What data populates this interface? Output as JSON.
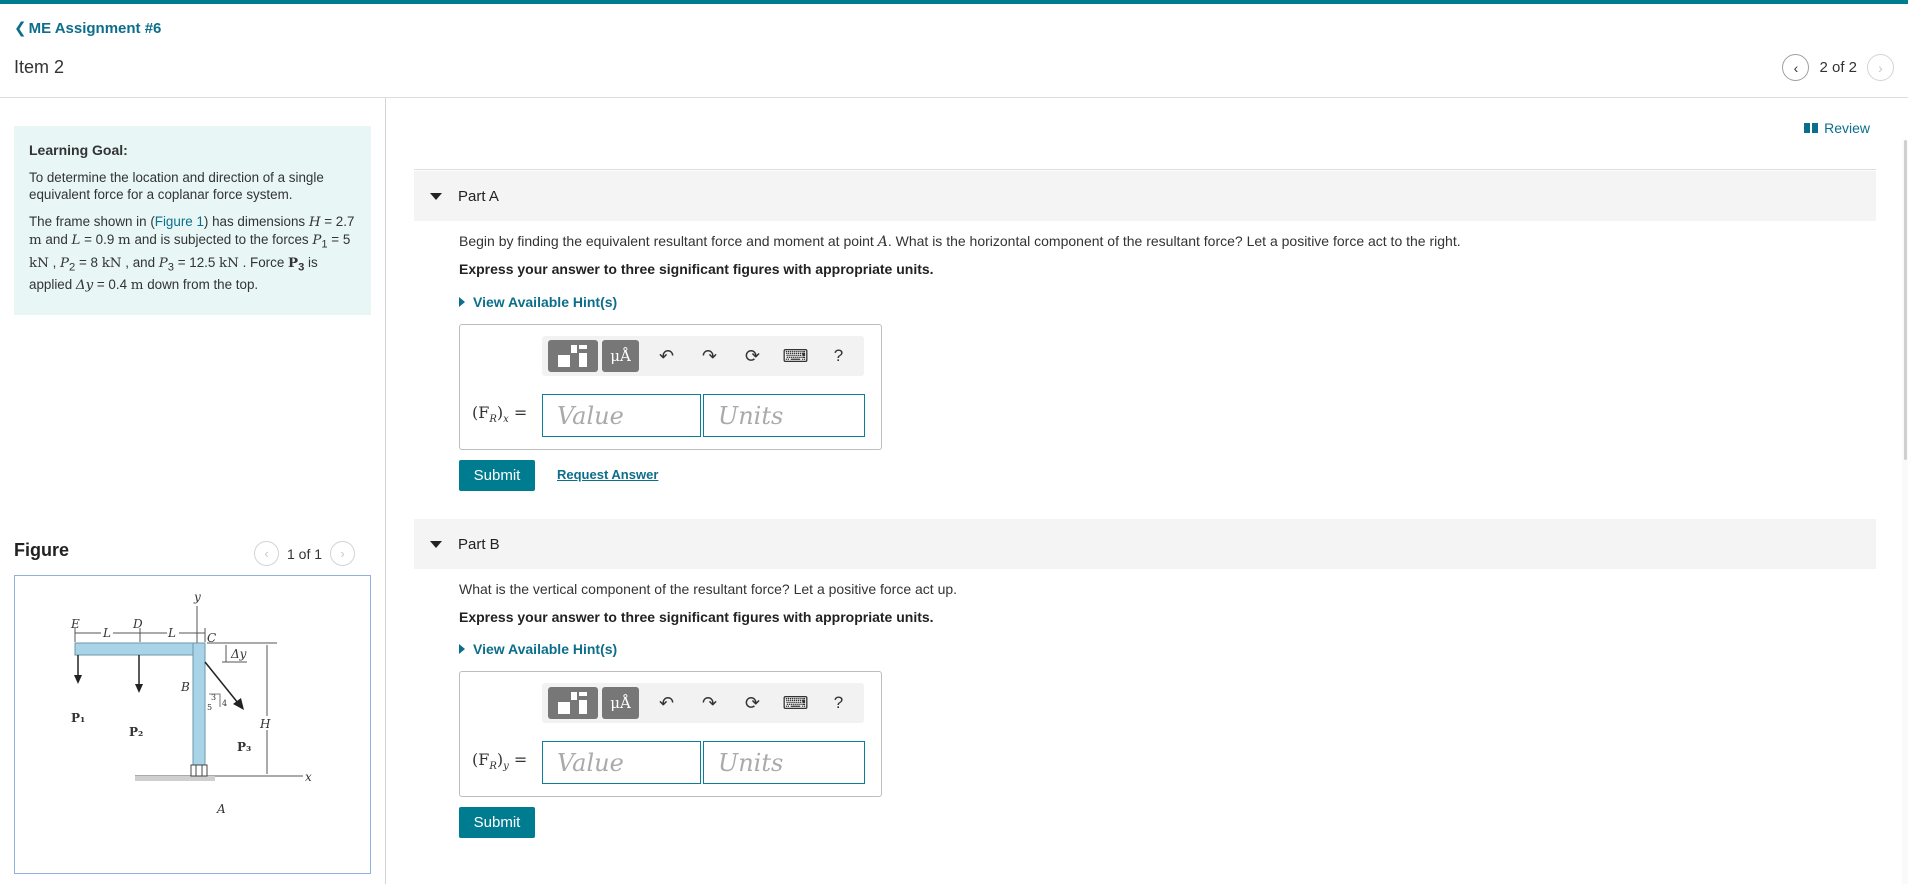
{
  "nav": {
    "back_label": "ME Assignment #6",
    "item_title": "Item 2",
    "pager_text": "2 of 2"
  },
  "learning_goal": {
    "heading": "Learning Goal:",
    "goal_text": "To determine the location and direction of a single equivalent force for a coplanar force system.",
    "problem": {
      "t1": "The frame shown in (",
      "figure_link": "Figure 1",
      "t2": ") has dimensions ",
      "H_sym": "H",
      "t3": " = 2.7 ",
      "unit_m1": "m",
      "t4": " and ",
      "L_sym": "L",
      "t5": " = 0.9 ",
      "unit_m2": "m",
      "t6": " and is subjected to the forces ",
      "P1_sym": "P",
      "P1_sub": "1",
      "t7": " = 5 ",
      "unit_kN1": "kN",
      "t8": " , ",
      "P2_sym": "P",
      "P2_sub": "2",
      "t9": " = 8 ",
      "unit_kN2": "kN",
      "t10": " , and ",
      "P3_sym": "P",
      "P3_sub": "3",
      "t11": " = 12.5 ",
      "unit_kN3": "kN",
      "t12": " . Force ",
      "P3b_sym": "P",
      "P3b_sub": "3",
      "t13": " is applied ",
      "dy_sym": "Δy",
      "t14": " = 0.4 ",
      "unit_m3": "m",
      "t15": " down from the top."
    }
  },
  "figure": {
    "title": "Figure",
    "pager_text": "1 of 1",
    "labels": {
      "y": "y",
      "x": "x",
      "E": "E",
      "D": "D",
      "C": "C",
      "B": "B",
      "A": "A",
      "L1": "L",
      "L2": "L",
      "dy": "Δy",
      "H": "H",
      "P1": "P₁",
      "P2": "P₂",
      "P3": "P₃",
      "slope_3": "3",
      "slope_4": "4",
      "slope_5": "5"
    }
  },
  "review_label": "Review",
  "partA": {
    "label": "Part A",
    "question_pre": "Begin by finding the equivalent resultant force and moment at point ",
    "question_point": "A",
    "question_post": ". What is the horizontal component of the resultant force? Let a positive force act to the right.",
    "instruction": "Express your answer to three significant figures with appropriate units.",
    "hints": "View Available Hint(s)",
    "units_btn": "μÅ",
    "help_btn": "?",
    "lhs": "(F",
    "lhs_sub": "R",
    "lhs_close": ")",
    "lhs_axis": "x",
    "eq": " =",
    "value_placeholder": "Value",
    "units_placeholder": "Units",
    "submit": "Submit",
    "request": "Request Answer"
  },
  "partB": {
    "label": "Part B",
    "question": "What is the vertical component of the resultant force? Let a positive force act up.",
    "instruction": "Express your answer to three significant figures with appropriate units.",
    "hints": "View Available Hint(s)",
    "units_btn": "μÅ",
    "help_btn": "?",
    "lhs": "(F",
    "lhs_sub": "R",
    "lhs_close": ")",
    "lhs_axis": "y",
    "eq": " =",
    "value_placeholder": "Value",
    "units_placeholder": "Units",
    "submit": "Submit"
  },
  "colors": {
    "accent": "#007c91",
    "link": "#0c6e8a",
    "goal_bg": "#e8f6f6",
    "frame": "#a9d3e6"
  }
}
